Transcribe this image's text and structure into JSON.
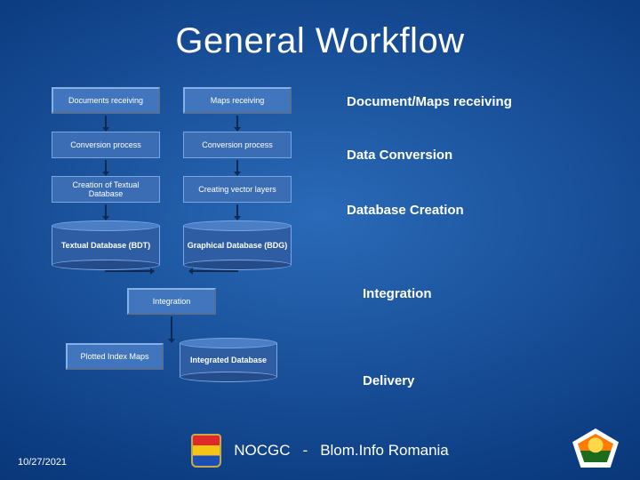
{
  "title": "General Workflow",
  "flow": {
    "left": {
      "n1": "Documents receiving",
      "n2": "Conversion process",
      "n3": "Creation of Textual Database",
      "db": "Textual Database (BDT)"
    },
    "right": {
      "n1": "Maps receiving",
      "n2": "Conversion process",
      "n3": "Creating vector layers",
      "db": "Graphical Database (BDG)"
    },
    "integration": "Integration",
    "out_left": "Plotted Index Maps",
    "out_right": "Integrated Database"
  },
  "labels": {
    "l1": "Document/Maps receiving",
    "l2": "Data Conversion",
    "l3": "Database Creation",
    "l4": "Integration",
    "l5": "Delivery"
  },
  "footer": {
    "date": "10/27/2021",
    "org": "NOCGC",
    "sep": "-",
    "company": "Blom.Info Romania"
  }
}
